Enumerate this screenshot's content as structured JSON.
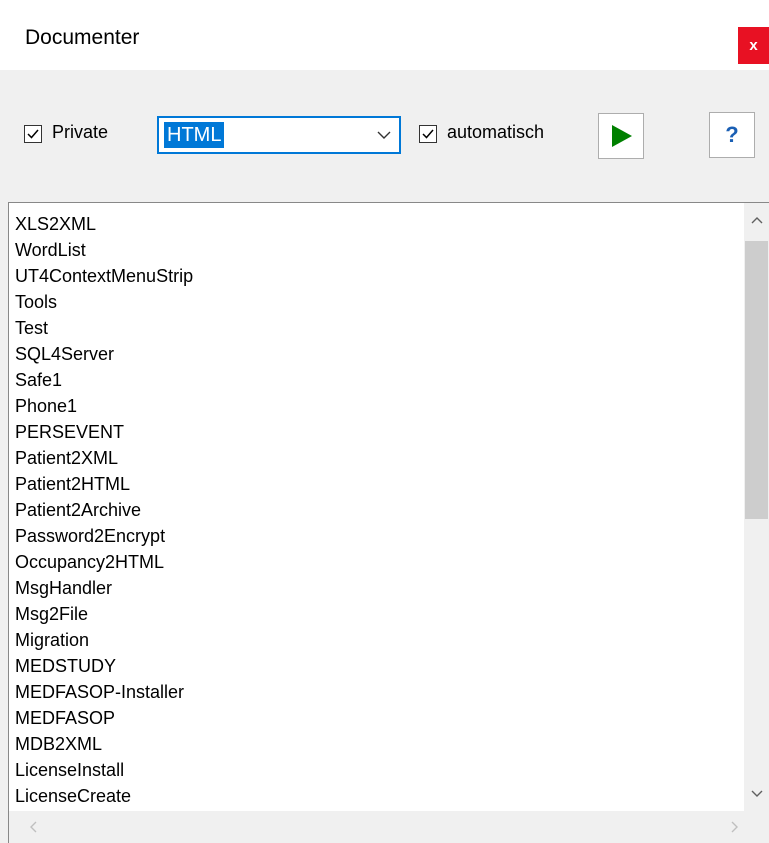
{
  "window": {
    "title": "Documenter",
    "close_label": "x"
  },
  "toolbar": {
    "private_label": "Private",
    "private_checked": true,
    "format_selected": "HTML",
    "auto_label": "automatisch",
    "auto_checked": true,
    "run_icon": "play-icon",
    "help_label": "?"
  },
  "list": {
    "items": [
      "XLS2XML",
      "WordList",
      "UT4ContextMenuStrip",
      "Tools",
      "Test",
      "SQL4Server",
      "Safe1",
      "Phone1",
      "PERSEVENT",
      "Patient2XML",
      "Patient2HTML",
      "Patient2Archive",
      "Password2Encrypt",
      "Occupancy2HTML",
      "MsgHandler",
      "Msg2File",
      "Migration",
      "MEDSTUDY",
      "MEDFASOP-Installer",
      "MEDFASOP",
      "MDB2XML",
      "LicenseInstall",
      "LicenseCreate"
    ]
  },
  "colors": {
    "accent": "#0078d7",
    "close": "#e81123",
    "play": "#008000"
  }
}
